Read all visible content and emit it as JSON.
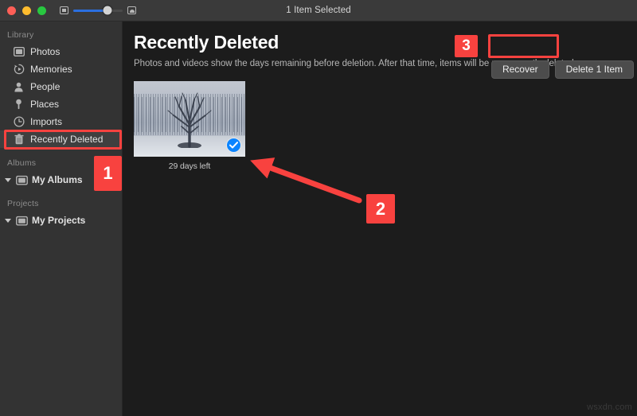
{
  "window": {
    "title": "1 Item Selected",
    "traffic_lights": [
      {
        "name": "close",
        "color": "#ff5f57"
      },
      {
        "name": "minimize",
        "color": "#febc2e"
      },
      {
        "name": "maximize",
        "color": "#28c840"
      }
    ],
    "zoom_slider": {
      "small_icon": "small-thumbnail-icon",
      "large_icon": "large-thumbnail-icon",
      "value_percent": 70,
      "accent": "#2b6fe0"
    }
  },
  "sidebar": {
    "groups": [
      {
        "label": "Library",
        "items": [
          {
            "label": "Photos",
            "icon": "photos-icon",
            "selected": false
          },
          {
            "label": "Memories",
            "icon": "memories-icon",
            "selected": false
          },
          {
            "label": "People",
            "icon": "people-icon",
            "selected": false
          },
          {
            "label": "Places",
            "icon": "places-pin-icon",
            "selected": false
          },
          {
            "label": "Imports",
            "icon": "imports-clock-icon",
            "selected": false
          },
          {
            "label": "Recently Deleted",
            "icon": "trash-icon",
            "selected": true
          }
        ]
      },
      {
        "label": "Albums",
        "items": [
          {
            "label": "My Albums",
            "icon": "folder-icon",
            "disclosure": "chevron-down-icon"
          }
        ]
      },
      {
        "label": "Projects",
        "items": [
          {
            "label": "My Projects",
            "icon": "folder-icon",
            "disclosure": "chevron-down-icon"
          }
        ]
      }
    ]
  },
  "main": {
    "title": "Recently Deleted",
    "subtitle": "Photos and videos show the days remaining before deletion. After that time, items will be permanently deleted.",
    "buttons": {
      "recover": "Recover",
      "delete": "Delete 1 Item"
    },
    "photos": [
      {
        "caption": "29 days left",
        "selected": true,
        "description": "bare winter tree in snowy field"
      }
    ]
  },
  "annotations": {
    "color": "#f8423f",
    "steps": [
      {
        "number": "1",
        "target": "sidebar-item-recently-deleted"
      },
      {
        "number": "2",
        "target": "photo-thumbnail-selection"
      },
      {
        "number": "3",
        "target": "recover-button"
      }
    ]
  },
  "watermark": "wsxdn.com"
}
